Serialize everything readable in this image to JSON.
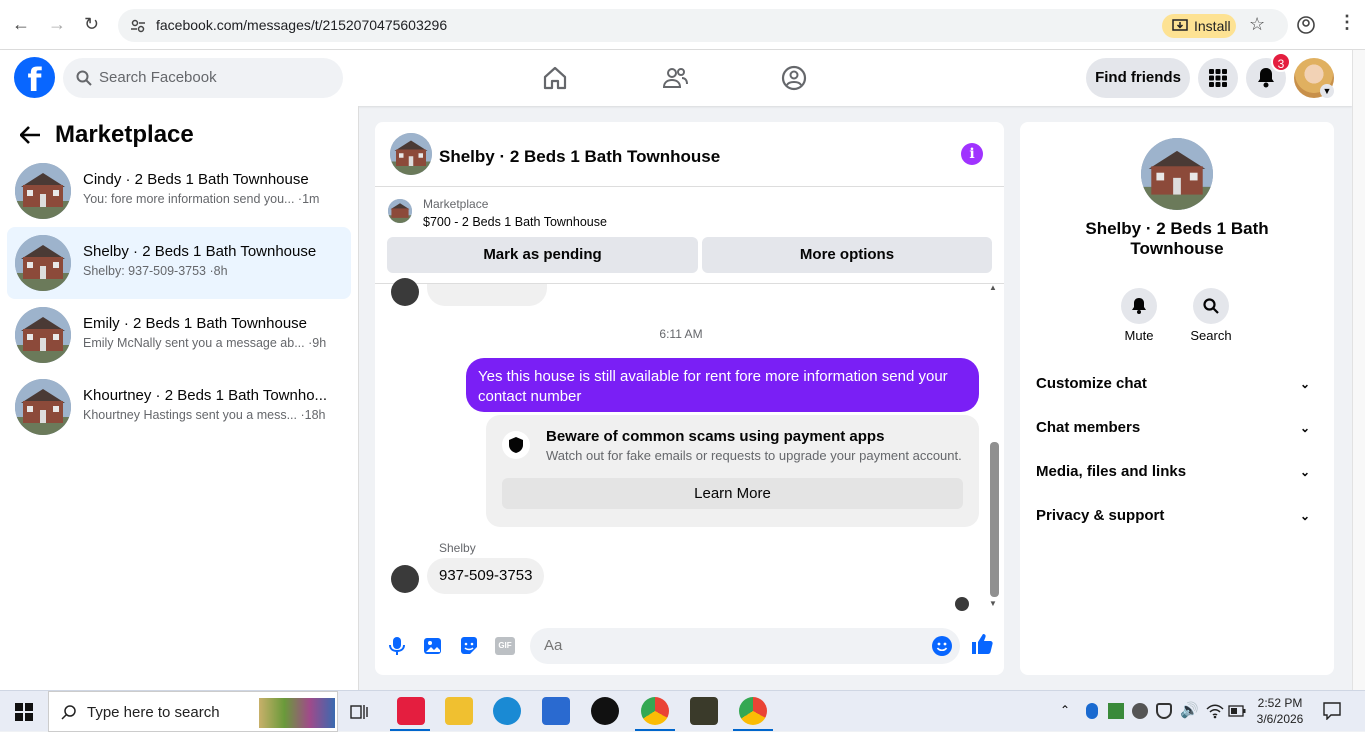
{
  "browser": {
    "url": "facebook.com/messages/t/2152070475603296",
    "install_label": "Install"
  },
  "header": {
    "search_placeholder": "Search Facebook",
    "find_friends_label": "Find friends",
    "notification_count": "3"
  },
  "sidebar": {
    "title": "Marketplace",
    "conversations": [
      {
        "name": "Cindy · 2 Beds 1 Bath Townhouse",
        "preview": "You: fore more information send you... ·1m"
      },
      {
        "name": "Shelby · 2 Beds 1 Bath Townhouse",
        "preview": "Shelby: 937-509-3753 ·8h"
      },
      {
        "name": "Emily · 2 Beds 1 Bath Townhouse",
        "preview": "Emily McNally sent you a message ab... ·9h"
      },
      {
        "name": "Khourtney · 2 Beds 1 Bath Townho...",
        "preview": "Khourtney Hastings sent you a mess... ·18h"
      }
    ]
  },
  "chat": {
    "title": "Shelby · 2 Beds 1 Bath Townhouse",
    "marketplace_label": "Marketplace",
    "listing": "$700 - 2 Beds 1 Bath Townhouse",
    "mark_pending_label": "Mark as pending",
    "more_options_label": "More options",
    "timestamp": "6:11 AM",
    "outgoing_message": "Yes this house is still available for rent fore more information send your contact number",
    "scam_title": "Beware of common scams using payment apps",
    "scam_text": "Watch out for fake emails or requests to upgrade your payment account.",
    "learn_more_label": "Learn More",
    "sender_name": "Shelby",
    "incoming_message": "937-509-3753",
    "input_placeholder": "Aa",
    "gif_label": "GIF"
  },
  "details": {
    "name": "Shelby · 2 Beds 1 Bath Townhouse",
    "mute_label": "Mute",
    "search_label": "Search",
    "sections": [
      "Customize chat",
      "Chat members",
      "Media, files and links",
      "Privacy & support"
    ]
  },
  "taskbar": {
    "search_placeholder": "Type here to search",
    "time": "2:52 PM",
    "date": "3/6/2026"
  },
  "colors": {
    "facebook_blue": "#0866ff",
    "message_purple": "#7a1ff5",
    "info_purple": "#a033ff",
    "selected_bg": "#ebf5ff"
  }
}
